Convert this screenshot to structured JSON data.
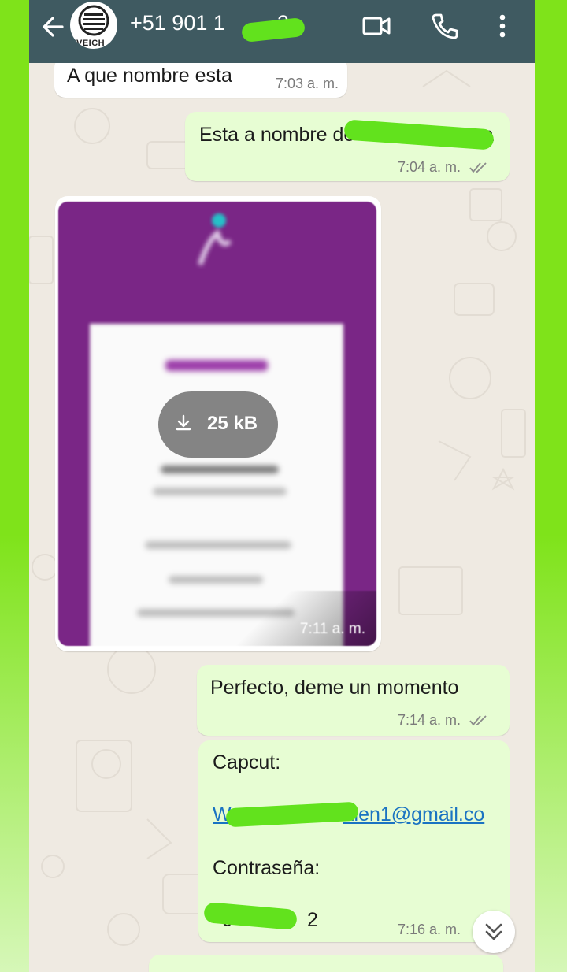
{
  "header": {
    "contact_number": "+51 901 1",
    "contact_suffix": "2",
    "avatar_text": "VEICH"
  },
  "messages": [
    {
      "text": "A que nombre esta",
      "time": "7:03 a. m."
    },
    {
      "text": "Esta a nombre de",
      "text_end": "a",
      "time": "7:04 a. m."
    },
    {
      "type": "image",
      "file_size": "25 kB",
      "time": "7:11 a. m."
    },
    {
      "text": "Perfecto, deme un momento",
      "time": "7:14 a. m."
    },
    {
      "label_1": "Capcut:",
      "email": "W",
      "email_end": "aien1@gmail.co",
      "label_2": "Contraseña:",
      "password_start": "c",
      "password_end": "2",
      "time": "7:16 a. m."
    }
  ],
  "colors": {
    "header": "#3f5a61",
    "outgoing": "#e7fdd3",
    "incoming": "#ffffff",
    "redaction": "#62e21d"
  }
}
